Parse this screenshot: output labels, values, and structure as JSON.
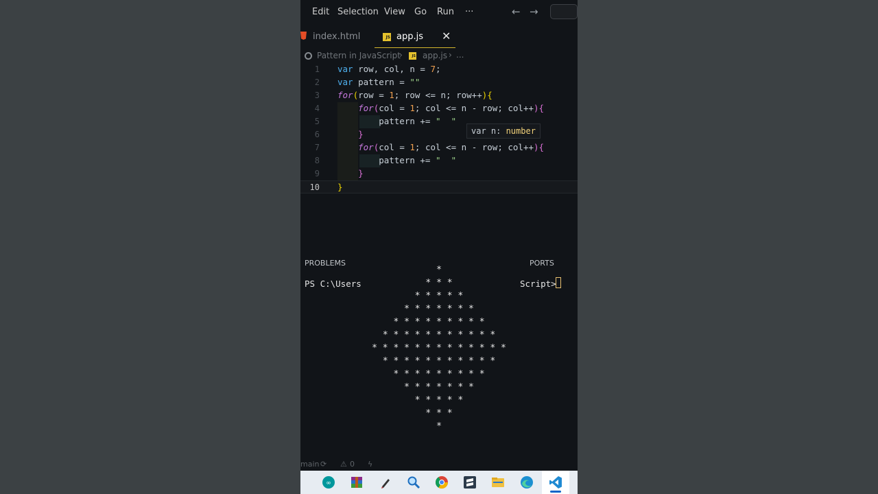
{
  "menu": {
    "items": [
      "Edit",
      "Selection",
      "View",
      "Go",
      "Run",
      "···"
    ]
  },
  "nav": {
    "back": "←",
    "forward": "→"
  },
  "tabs": [
    {
      "label": "index.html"
    },
    {
      "label": "app.js",
      "close": "✕"
    }
  ],
  "breadcrumb": {
    "folder": "Pattern in JavaScript",
    "file": "app.js",
    "more": "..."
  },
  "editor": {
    "line_numbers": [
      "1",
      "2",
      "3",
      "4",
      "5",
      "6",
      "7",
      "8",
      "9",
      "10"
    ],
    "active_line": "10",
    "tooltip": {
      "prefix": "var n: ",
      "type": "number"
    }
  },
  "panel": {
    "tab_problems": "PROBLEMS",
    "tab_ports": "PORTS",
    "prompt_left": "PS C:\\Users",
    "prompt_right": "Script>"
  },
  "output": {
    "pattern_rows": [
      "*",
      "* * *",
      "* * * * *",
      "* * * * * * *",
      "* * * * * * * * *",
      "* * * * * * * * * * *",
      "* * * * * * * * * * * * *",
      "* * * * * * * * * * *",
      "* * * * * * * * *",
      "* * * * * * *",
      "* * * * *",
      "* * *",
      "*"
    ]
  },
  "statusbar": {
    "branch": "main",
    "warnings": "0"
  },
  "colors": {
    "keyword": "#4fb1f0",
    "control": "#c678dd",
    "number": "#f0a050",
    "string": "#9ed28a",
    "bracket": "#f1d700",
    "tab_accent": "#d4b72c"
  },
  "taskbar": {
    "icons": [
      "arduino-icon",
      "winrar-icon",
      "pen-icon",
      "search-magnifier-icon",
      "chrome-icon",
      "sublime-icon",
      "file-explorer-icon",
      "edge-icon",
      "vscode-icon"
    ]
  }
}
